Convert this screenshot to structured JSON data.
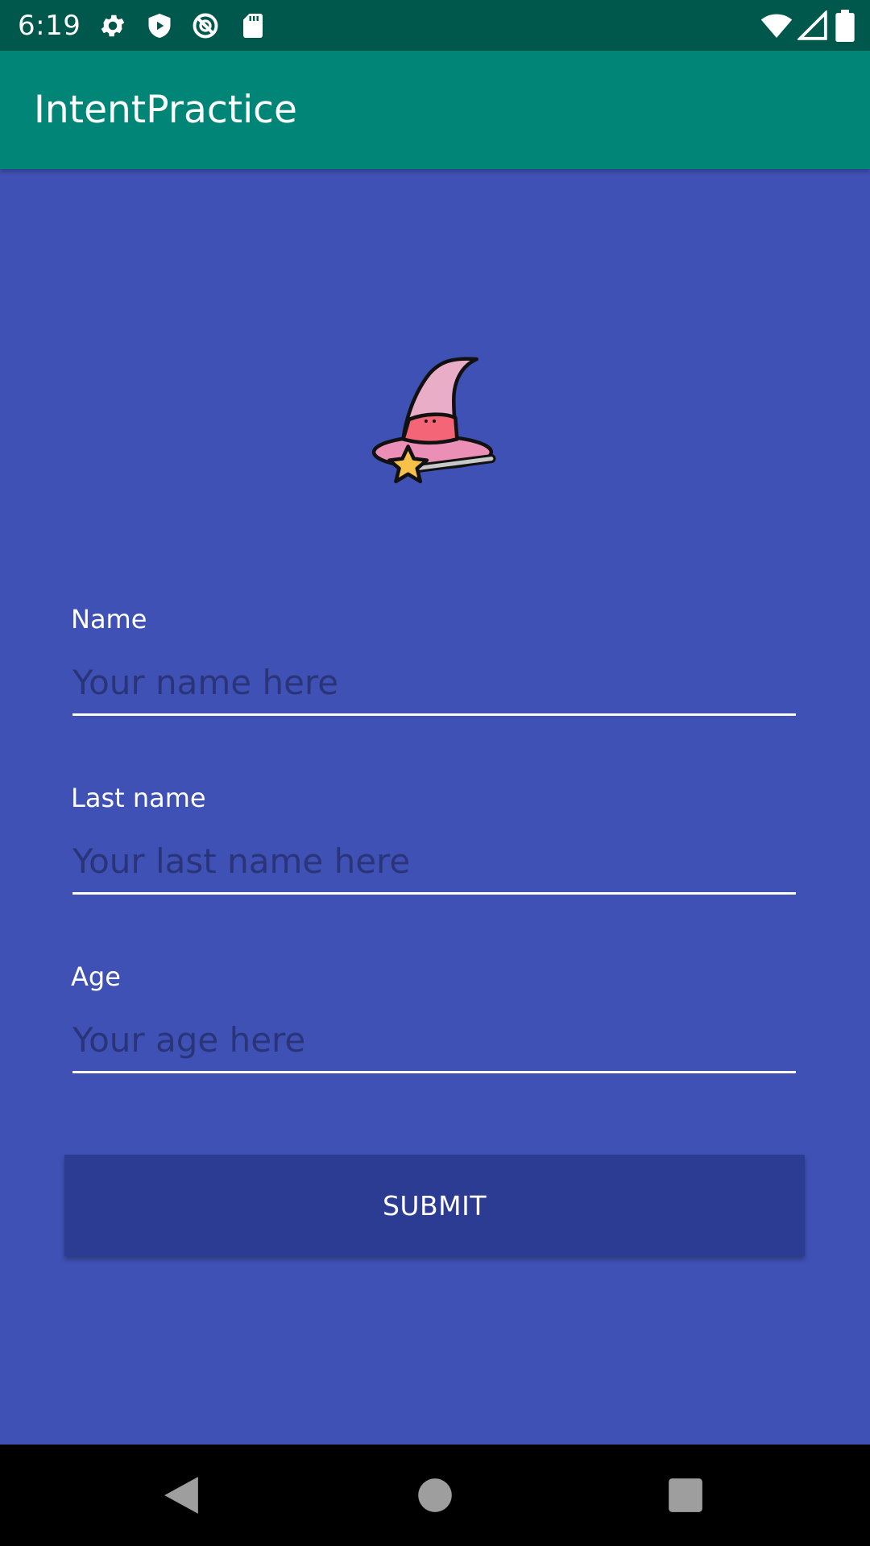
{
  "status_bar": {
    "time": "6:19",
    "left_icons": [
      "gear-icon",
      "shield-play-icon",
      "no-symbol-icon",
      "sd-card-icon"
    ],
    "right_icons": [
      "wifi-icon",
      "signal-icon",
      "battery-icon"
    ]
  },
  "app_bar": {
    "title": "IntentPractice"
  },
  "form": {
    "logo_icon": "wizard-hat-icon",
    "fields": [
      {
        "label": "Name",
        "value": "",
        "placeholder": "Your name here"
      },
      {
        "label": "Last name",
        "value": "",
        "placeholder": "Your last name here"
      },
      {
        "label": "Age",
        "value": "",
        "placeholder": "Your age here"
      }
    ],
    "submit_label": "SUBMIT"
  },
  "nav_bar": {
    "buttons": [
      "back-icon",
      "home-icon",
      "recents-icon"
    ]
  },
  "colors": {
    "status_bar": "#00574B",
    "app_bar": "#008577",
    "background": "#3F51B5",
    "button": "#2C3C93",
    "placeholder": "#2A3579"
  }
}
